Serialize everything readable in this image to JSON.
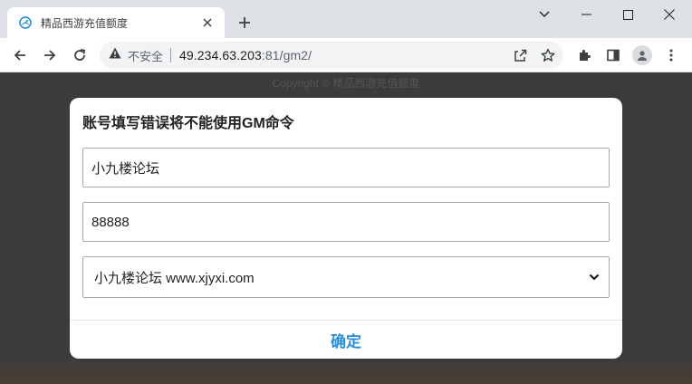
{
  "browser": {
    "tab_title": "精品西游充值额度",
    "new_tab_symbol": "+",
    "security_label": "不安全",
    "url_host": "49.234.63.203",
    "url_rest": ":81/gm2/"
  },
  "page": {
    "copyright": "Copyright © 精品西游充值额度"
  },
  "modal": {
    "title": "账号填写错误将不能使用GM命令",
    "account_value": "小九楼论坛",
    "password_value": "88888",
    "server_selected": "小九楼论坛 www.xjyxi.com",
    "confirm_label": "确定"
  },
  "colors": {
    "accent": "#2f8ed6",
    "page_background": "#3b3b3b",
    "tabbar": "#dee1e6"
  }
}
